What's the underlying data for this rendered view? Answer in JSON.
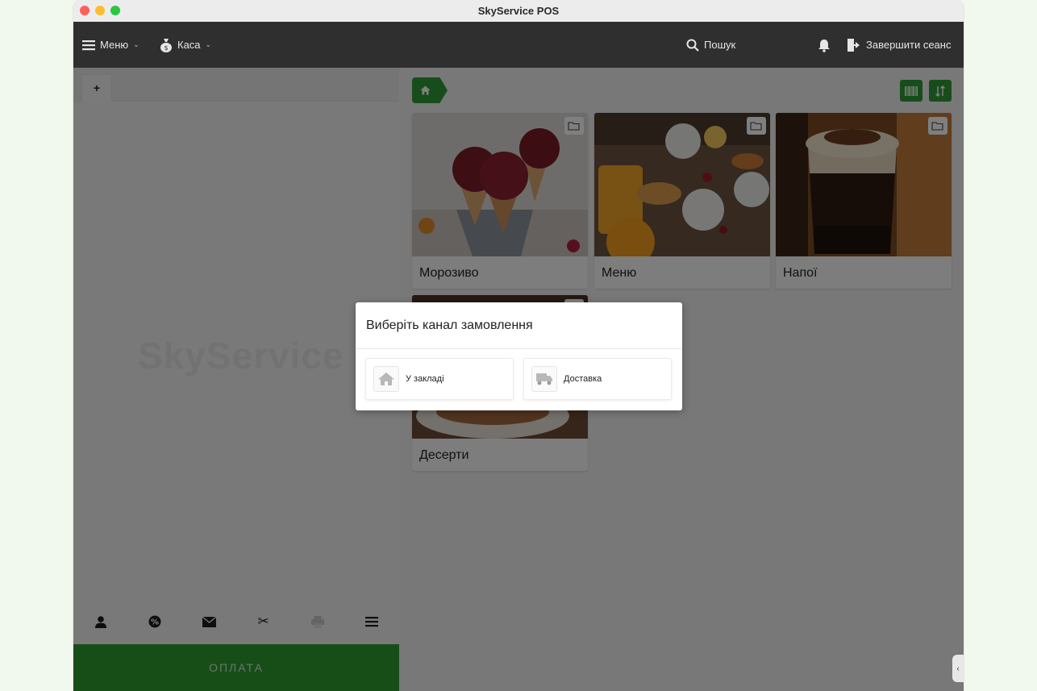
{
  "window": {
    "title": "SkyService POS"
  },
  "navbar": {
    "menu_label": "Меню",
    "cash_label": "Каса",
    "search_label": "Пошук",
    "logout_label": "Завершити сеанс"
  },
  "order_panel": {
    "new_tab_label": "+",
    "watermark": "SkyService",
    "pay_label": "ОПЛАТА",
    "toolbar_icons": [
      "user-icon",
      "discount-icon",
      "envelope-icon",
      "scissors-icon",
      "printer-icon",
      "menu-icon"
    ]
  },
  "catalog": {
    "breadcrumb_icon": "home-icon",
    "tiles": [
      {
        "label": "Морозиво",
        "icon": "folder-icon"
      },
      {
        "label": "Меню",
        "icon": "folder-icon"
      },
      {
        "label": "Напої",
        "icon": "folder-icon"
      },
      {
        "label": "Десерти",
        "icon": "folder-icon"
      }
    ]
  },
  "modal": {
    "title": "Виберіть канал замовлення",
    "options": [
      {
        "label": "У закладі",
        "icon": "house-icon"
      },
      {
        "label": "Доставка",
        "icon": "truck-icon"
      }
    ]
  },
  "colors": {
    "accent": "#2f9b34",
    "navbar": "#2f2f2f",
    "overlay": "rgba(0,0,0,0.5)"
  }
}
